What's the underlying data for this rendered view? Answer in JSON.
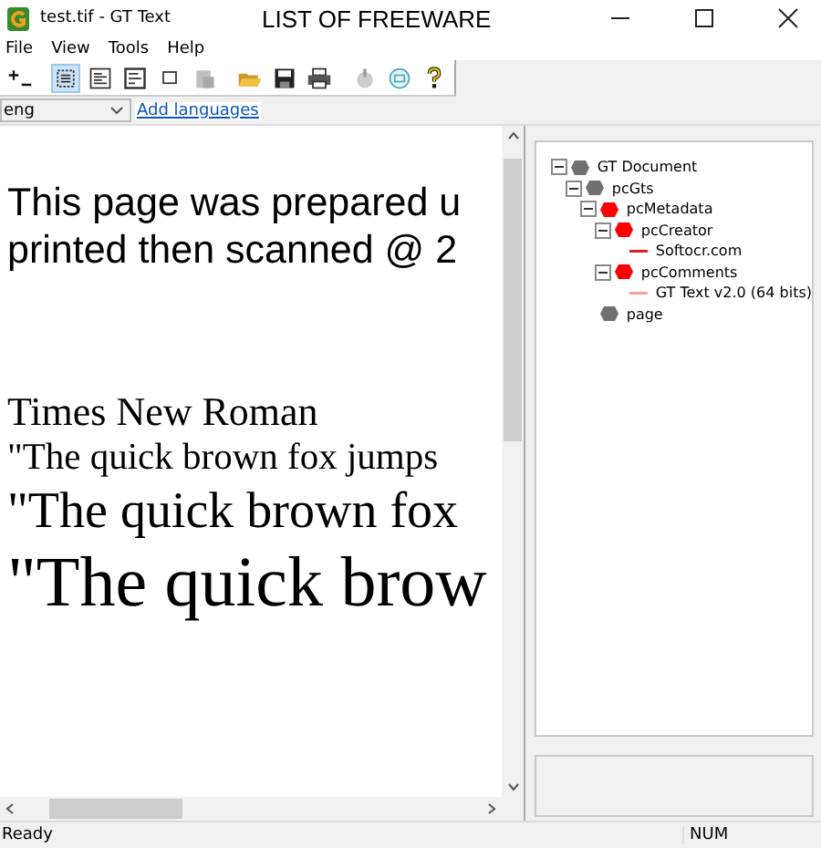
{
  "window": {
    "title": "test.tif - GT Text"
  },
  "heading": "LIST OF FREEWARE",
  "menu": [
    "File",
    "View",
    "Tools",
    "Help"
  ],
  "toolbar": [
    {
      "selected": false
    },
    {
      "selected": true
    },
    {
      "selected": false
    },
    {
      "selected": false
    },
    {
      "selected": false
    },
    {
      "selected": false
    },
    {
      "selected": false
    },
    {
      "selected": false
    },
    {
      "selected": false
    },
    {
      "selected": false
    },
    {
      "selected": false
    },
    {
      "selected": false
    }
  ],
  "language": {
    "value": "eng",
    "link": "Add languages"
  },
  "document": [
    {
      "text": "This page was prepared u",
      "kind": "sans"
    },
    {
      "text": "printed then scanned @ 2",
      "kind": "sans"
    },
    {
      "text": "Times New Roman",
      "kind": "serif-m"
    },
    {
      "text": "\"The quick brown fox jumps",
      "kind": "serif-s"
    },
    {
      "text": "\"The quick brown fox",
      "kind": "serif-m2"
    },
    {
      "text": "\"The quick brow",
      "kind": "serif-l"
    }
  ],
  "tree": [
    {
      "label": "GT Document",
      "kind": "element",
      "color": "#707070",
      "expanded": true,
      "children": [
        {
          "label": "pcGts",
          "kind": "element",
          "color": "#707070",
          "expanded": true,
          "children": [
            {
              "label": "pcMetadata",
              "kind": "element",
              "color": "#ff0000",
              "expanded": true,
              "children": [
                {
                  "label": "pcCreator",
                  "kind": "element",
                  "color": "#ff0000",
                  "expanded": true,
                  "children": [
                    {
                      "label": "Softocr.com",
                      "kind": "value",
                      "color": "#e02020"
                    }
                  ]
                },
                {
                  "label": "pcComments",
                  "kind": "element",
                  "color": "#ff0000",
                  "expanded": true,
                  "children": [
                    {
                      "label": "GT Text v2.0 (64 bits)",
                      "kind": "value",
                      "color": "#f0a0a0"
                    }
                  ]
                }
              ]
            },
            {
              "label": "page",
              "kind": "element",
              "color": "#707070"
            }
          ]
        }
      ]
    }
  ],
  "status_bar": {
    "text": "Ready",
    "num": "NUM"
  }
}
